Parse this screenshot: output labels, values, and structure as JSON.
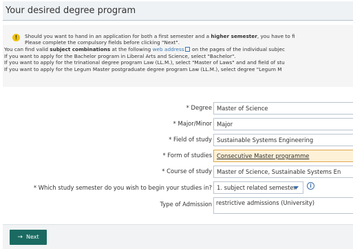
{
  "header": {
    "title": "Your desired degree program"
  },
  "info": {
    "line1_pre": "Should you want to hand in an application for both a first semester and a ",
    "line1_bold": "higher semester",
    "line1_post": ", you have to fi",
    "line2": "Please complete the compulsory fields before clicking \"Next\".",
    "line3_pre": "You can find valid ",
    "line3_bold": "subject combinations",
    "line3_mid": " at the following ",
    "line3_link": "web address",
    "line3_post": " on the pages of the individual subjec",
    "line4": "If you want to apply for the Bachelor program in Liberal Arts and Science, select \"Bachelor\".",
    "line5": "If you want to apply for the trinational degree program Law (LL.M.), select \"Master of Laws\" and and field of stu",
    "line6": "If you want to apply for the Legum Master postgraduate degree program Law (LL.M.), select degree \"Legum M"
  },
  "form": {
    "degree_label": "* Degree",
    "degree_value": "Master of Science",
    "major_label": "* Major/Minor",
    "major_value": "Major",
    "field_label": "* Field of study",
    "field_value": "Sustainable Systems Engineering",
    "form_label": "* Form of studies",
    "form_value": "Consecutive Master programme",
    "course_label": "* Course of study",
    "course_value": "Master of Science, Sustainable Systems En",
    "semester_label": "* Which study semester do you wish to begin your studies in?",
    "semester_value": "1. subject related semester",
    "admission_label": "Type of Admission",
    "admission_value": "restrictive admissions (University)"
  },
  "footer": {
    "next_label": "Next"
  },
  "icons": {
    "info": "info-icon",
    "help": "help-icon",
    "external_link": "external-link-icon",
    "arrow": "arrow-right-icon"
  },
  "colors": {
    "title_bar": "#eef2f5",
    "info_bg": "#f5f5f5",
    "highlight_bg": "#fdf1d8",
    "next_button": "#1a6a61",
    "link": "#3b78b0"
  }
}
